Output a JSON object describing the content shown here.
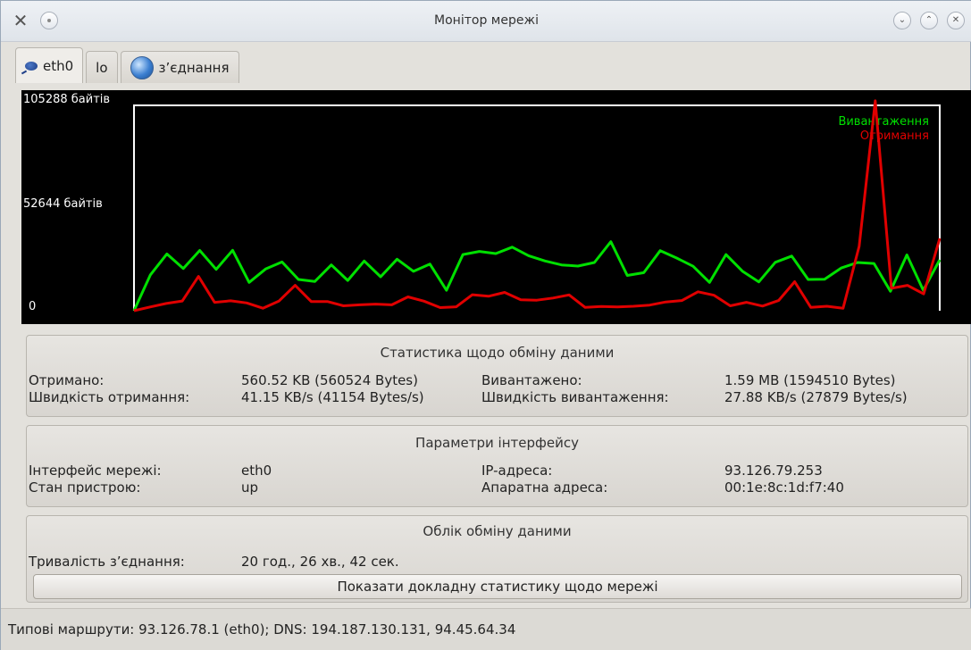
{
  "window": {
    "title": "Монітор мережі",
    "app_icon": "tools-icon"
  },
  "tabs": [
    {
      "label": "eth0",
      "icon": "network-icon"
    },
    {
      "label": "lo"
    },
    {
      "label": "з’єднання",
      "icon": "globe-icon"
    }
  ],
  "graph": {
    "y_top_label": "105288 байтів",
    "y_mid_label": "52644 байтів",
    "y_zero_label": "0",
    "legend_upload": "Вивантаження",
    "legend_download": "Отримання",
    "upload_color": "#00e000",
    "download_color": "#e00000"
  },
  "chart_data": {
    "type": "line",
    "ylim": [
      0,
      105288
    ],
    "series": [
      {
        "name": "Вивантаження",
        "values": [
          0,
          18400,
          29100,
          21600,
          30900,
          21200,
          31000,
          14500,
          21400,
          25000,
          16000,
          15000,
          23500,
          15500,
          25500,
          17400,
          26400,
          20200,
          23900,
          10500,
          28800,
          30400,
          29300,
          32600,
          28200,
          25500,
          23500,
          22900,
          24700,
          35400,
          18100,
          19500,
          30800,
          27000,
          22800,
          14500,
          28800,
          20300,
          14800,
          24800,
          28000,
          16000,
          16100,
          21900,
          24700,
          24200,
          10000,
          28600,
          10500,
          26100
        ]
      },
      {
        "name": "Отримання",
        "values": [
          0,
          1900,
          3700,
          5000,
          17600,
          4300,
          5100,
          4000,
          1300,
          5000,
          13000,
          4700,
          4700,
          2500,
          3000,
          3400,
          3000,
          7100,
          4900,
          1600,
          2000,
          8200,
          7400,
          9400,
          5600,
          5400,
          6500,
          8100,
          1700,
          2200,
          1900,
          2300,
          2900,
          4500,
          5200,
          9700,
          7900,
          2500,
          4300,
          2400,
          5200,
          14900,
          1700,
          2300,
          1300,
          33000,
          107600,
          11500,
          13000,
          8600,
          37100
        ]
      }
    ]
  },
  "traffic_stats": {
    "title": "Статистика щодо обміну даними",
    "received_label": "Отримано:",
    "received_value": "560.52 KB (560524 Bytes)",
    "uploaded_label": "Вивантажено:",
    "uploaded_value": "1.59 MB (1594510 Bytes)",
    "down_speed_label": "Швидкість отримання:",
    "down_speed_value": "41.15 KB/s (41154 Bytes/s)",
    "up_speed_label": "Швидкість вивантаження:",
    "up_speed_value": "27.88 KB/s (27879 Bytes/s)"
  },
  "interface_params": {
    "title": "Параметри інтерфейсу",
    "iface_label": "Інтерфейс мережі:",
    "iface_value": "eth0",
    "ip_label": "IP-адреса:",
    "ip_value": "93.126.79.253",
    "state_label": "Стан пристрою:",
    "state_value": "up",
    "hw_label": "Апаратна адреса:",
    "hw_value": "00:1e:8c:1d:f7:40"
  },
  "accounting": {
    "title": "Облік обміну даними",
    "duration_label": "Тривалість з’єднання:",
    "duration_value": "20 год., 26 хв., 42 сек.",
    "details_button": "Показати докладну статистику щодо мережі"
  },
  "status_bar": {
    "text": "Типові маршрути: 93.126.78.1 (eth0); DNS: 194.187.130.131, 94.45.64.34"
  }
}
